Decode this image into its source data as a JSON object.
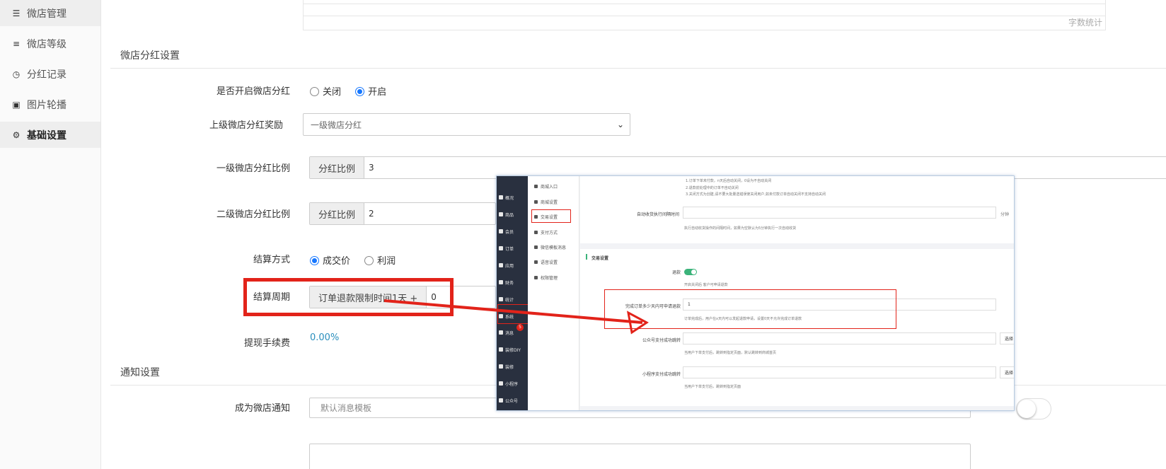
{
  "sidebar": {
    "items": [
      {
        "label": "微店管理",
        "icon": "list-icon"
      },
      {
        "label": "微店等级",
        "icon": "align-icon"
      },
      {
        "label": "分红记录",
        "icon": "clock-icon"
      },
      {
        "label": "图片轮播",
        "icon": "image-icon"
      },
      {
        "label": "基础设置",
        "icon": "gears-icon"
      }
    ]
  },
  "top": {
    "word_count": "字数统计"
  },
  "dividend": {
    "section_title": "微店分红设置",
    "enable_label": "是否开启微店分红",
    "enable_options": [
      "关闭",
      "开启"
    ],
    "enable_selected": "开启",
    "parent_reward_label": "上级微店分红奖励",
    "parent_reward_value": "一级微店分红",
    "level1_label": "一级微店分红比例",
    "level1_addon": "分红比例",
    "level1_value": "3",
    "level2_label": "二级微店分红比例",
    "level2_addon": "分红比例",
    "level2_value": "2",
    "settle_method_label": "结算方式",
    "settle_method_options": [
      "成交价",
      "利润"
    ],
    "settle_method_selected": "成交价",
    "settle_period_label": "结算周期",
    "settle_period_addon": "订单退款限制时间1天 +",
    "settle_period_value": "0",
    "fee_label": "提现手续费",
    "fee_value": "0.00%"
  },
  "notify": {
    "section_title": "通知设置",
    "become_label": "成为微店通知",
    "become_placeholder": "默认消息模板"
  },
  "overlay": {
    "nav": [
      "概况",
      "商品",
      "会员",
      "订单",
      "应用",
      "财务",
      "统计",
      "系统",
      "消息",
      "装修DIY",
      "装修",
      "小程序",
      "公众号"
    ],
    "badge": "5",
    "sub": [
      "商城入口",
      "商城设置",
      "交易设置",
      "支付方式",
      "微信模板消息",
      "语音设置",
      "权限管理"
    ],
    "tips": [
      "1.订单下单未付款，n天后自动关闭，0设为不自动关闭",
      "2.退款前处理中的订单不自动关闭",
      "3.关闭方式为创建,请不要大批量选错误使关闭用户,如未付款订单自动关闭不支持自动关闭"
    ],
    "auto_receive_label": "自动收货执行间隔时间",
    "auto_receive_suffix": "分钟",
    "auto_receive_note": "执行自动收货操作的间隔时间，如果为空默认为5分钟执行一次自动收货",
    "section": "交易设置",
    "refund_label": "退款",
    "refund_note": "开启关闭后 客户可申请退款",
    "days_label": "完成订单多少天内可申请退款",
    "days_value": "1",
    "days_note": "订单完成后，用户在x天内可以发起退款申请，设置0天不允许完成订单退款",
    "mp_pay_label": "公众号支付成功跳转",
    "mp_pay_suffix": "选择",
    "mp_pay_note": "当用户下单支付后，跳转到指定页面，默认跳转到商城首页",
    "mini_pay_label": "小程序支付成功跳转",
    "mini_pay_suffix": "选择",
    "mini_pay_note": "当用户下单支付后，跳转到指定页面"
  },
  "colors": {
    "accent": "#1677ff",
    "fee": "#2a8fbd",
    "annotation": "#e2231a",
    "toggle_on": "#3bb37a"
  }
}
